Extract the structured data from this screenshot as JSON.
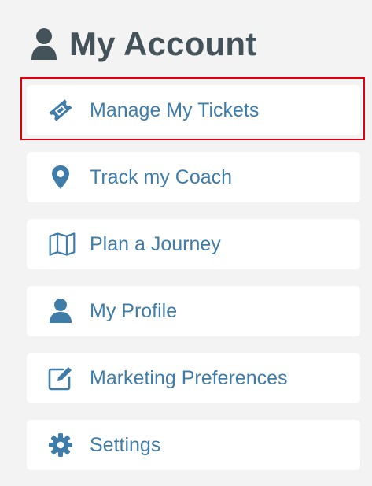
{
  "header": {
    "title": "My Account",
    "icon": "user-icon"
  },
  "menu": {
    "items": [
      {
        "label": "Manage My Tickets",
        "icon": "ticket-icon"
      },
      {
        "label": "Track my Coach",
        "icon": "map-pin-icon"
      },
      {
        "label": "Plan a Journey",
        "icon": "map-icon"
      },
      {
        "label": "My Profile",
        "icon": "user-icon"
      },
      {
        "label": "Marketing Preferences",
        "icon": "edit-icon"
      },
      {
        "label": "Settings",
        "icon": "gear-icon"
      }
    ]
  },
  "colors": {
    "background": "#f3f3f3",
    "card": "#ffffff",
    "header_text": "#44525a",
    "link_text": "#3f7da8",
    "icon": "#3f7da8",
    "highlight": "#e0000c"
  }
}
